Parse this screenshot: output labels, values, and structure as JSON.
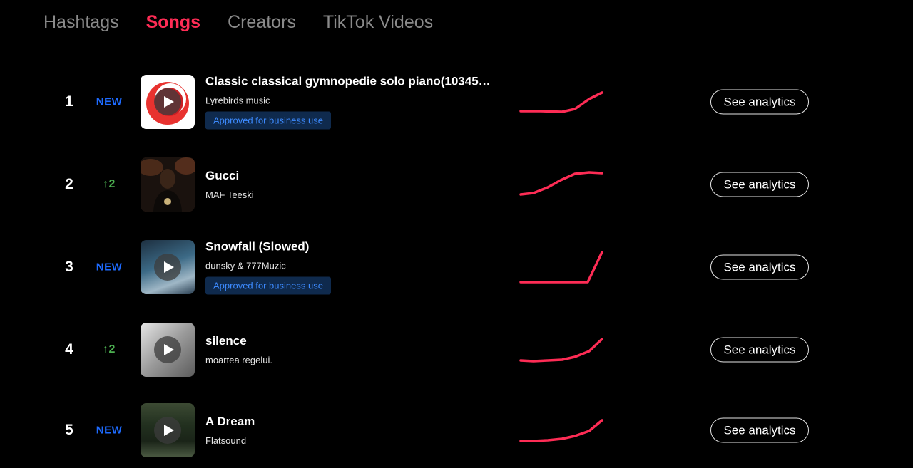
{
  "tabs": [
    {
      "label": "Hashtags",
      "active": false
    },
    {
      "label": "Songs",
      "active": true
    },
    {
      "label": "Creators",
      "active": false
    },
    {
      "label": "TikTok Videos",
      "active": false
    }
  ],
  "accent_color": "#fe2c55",
  "songs": [
    {
      "rank": "1",
      "change": "NEW",
      "title": "Classic classical gymnopedie solo piano(10345…",
      "artist": "Lyrebirds music",
      "badge": "Approved for business use",
      "analytics_label": "See analytics"
    },
    {
      "rank": "2",
      "change": "↑2",
      "title": "Gucci",
      "artist": "MAF Teeski",
      "badge": "",
      "analytics_label": "See analytics"
    },
    {
      "rank": "3",
      "change": "NEW",
      "title": "Snowfall (Slowed)",
      "artist": "dunsky & 777Muzic",
      "badge": "Approved for business use",
      "analytics_label": "See analytics"
    },
    {
      "rank": "4",
      "change": "↑2",
      "title": "silence",
      "artist": "moartea regelui.",
      "badge": "",
      "analytics_label": "See analytics"
    },
    {
      "rank": "5",
      "change": "NEW",
      "title": "A Dream",
      "artist": "Flatsound",
      "badge": "",
      "analytics_label": "See analytics"
    }
  ]
}
